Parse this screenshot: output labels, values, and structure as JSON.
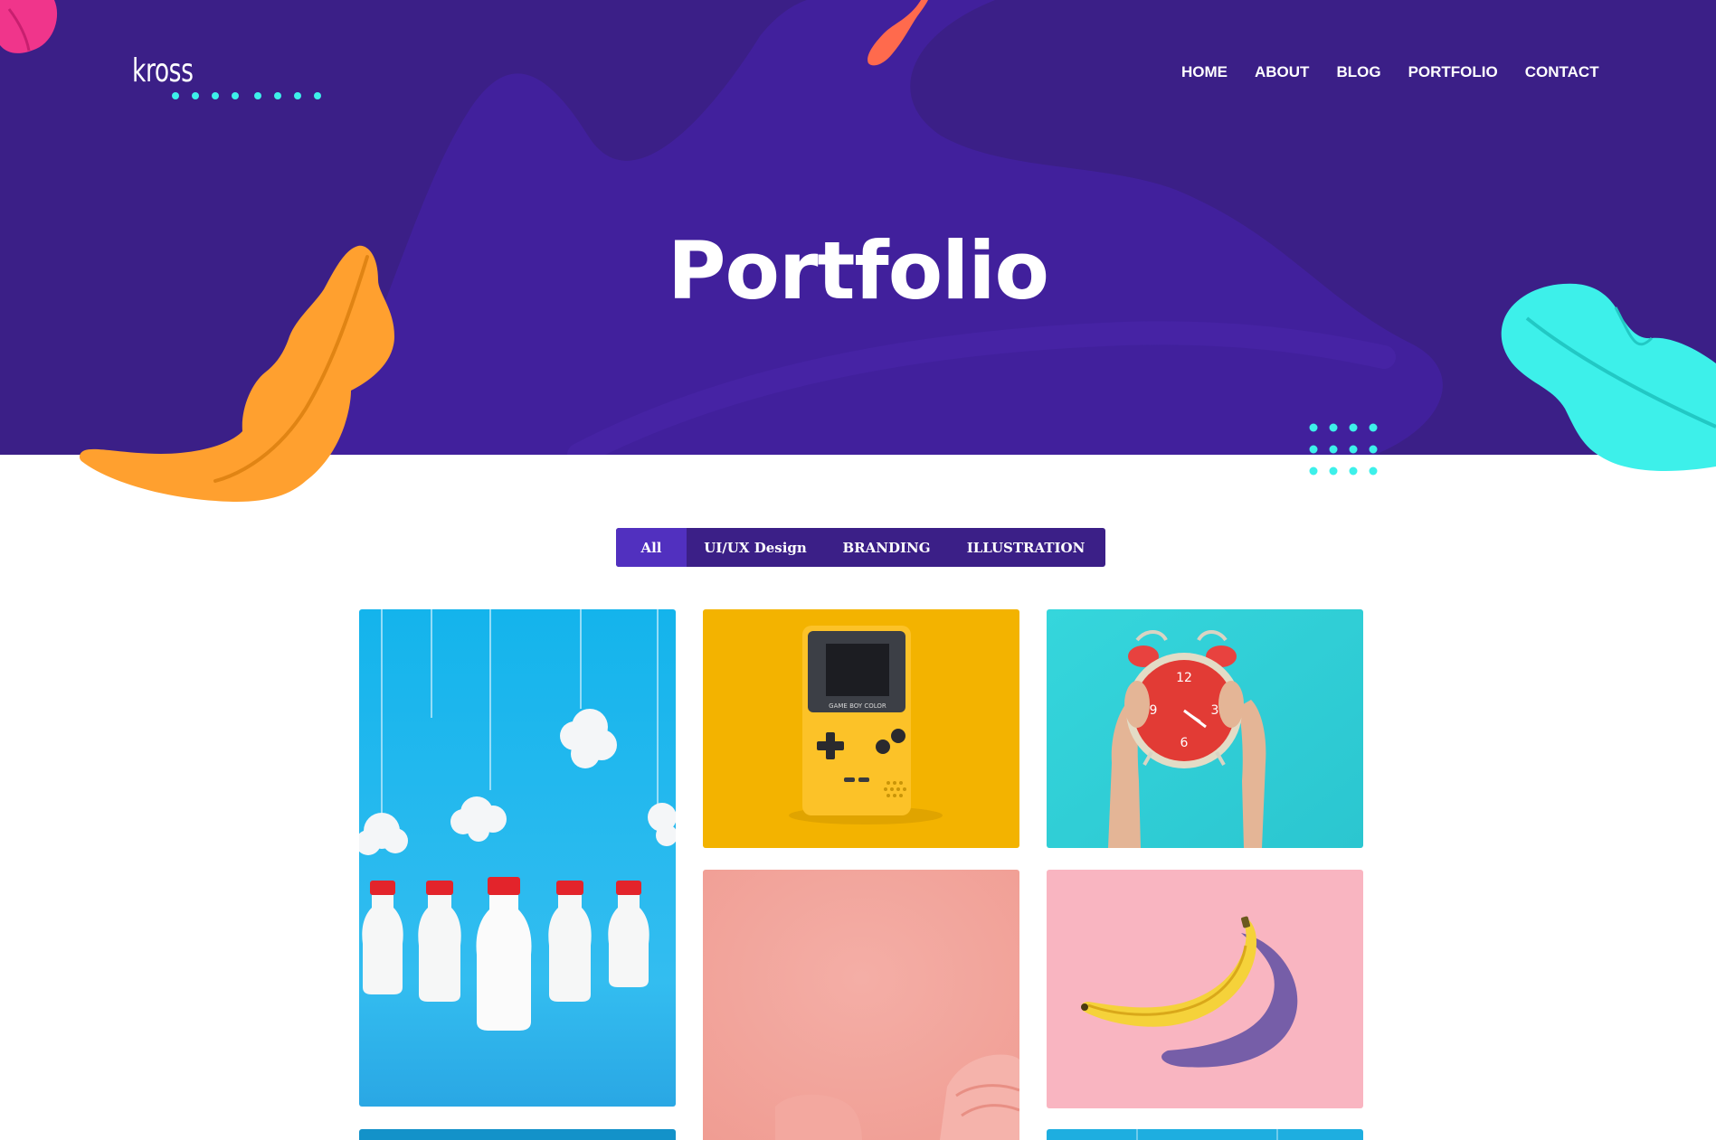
{
  "site": {
    "logo": "kross"
  },
  "nav": {
    "items": [
      "HOME",
      "ABOUT",
      "BLOG",
      "PORTFOLIO",
      "CONTACT"
    ]
  },
  "hero": {
    "title": "Portfolio"
  },
  "filters": {
    "items": [
      "All",
      "UI/UX Design",
      "BRANDING",
      "ILLUSTRATION"
    ],
    "active": "All"
  },
  "gallery": {
    "items": [
      {
        "subject": "milk bottles with cotton clouds"
      },
      {
        "subject": "yellow game boy color"
      },
      {
        "subject": "hands holding red alarm clock"
      },
      {
        "subject": "pink background with pink bag"
      },
      {
        "subject": "banana on pink background"
      }
    ],
    "device_label": "GAME BOY COLOR"
  },
  "colors": {
    "hero_bg": "#3b1f87",
    "filter_bg": "#3b1f87",
    "filter_active": "#5130bf",
    "accent_cyan": "#3df0ea",
    "accent_orange": "#ffa02f"
  }
}
